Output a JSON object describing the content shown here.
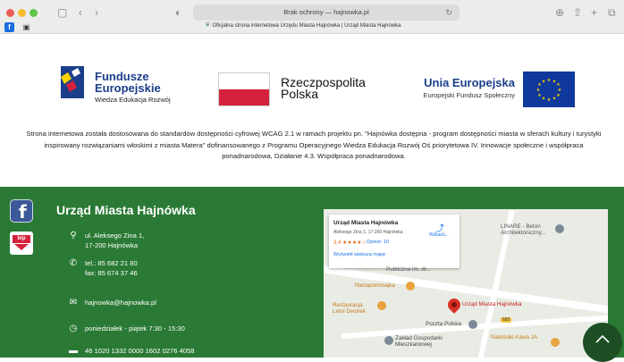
{
  "browser": {
    "address": "Brak ochrony — hajnowka.pl",
    "tab_title": "Oficjalna strona internetowa Urzędu Miasta Hajnówka | Urząd Miasta Hajnówka"
  },
  "logos": {
    "fe_line1": "Fundusze",
    "fe_line2": "Europejskie",
    "fe_line3": "Wiedza Edukacja Rozwój",
    "pl_line1": "Rzeczpospolita",
    "pl_line2": "Polska",
    "ue_line1": "Unia Europejska",
    "ue_line2": "Europejski Fundusz Społeczny"
  },
  "notice": "Strona internetowa została dostosowana do standardów dostępności cyfrowej WCAG 2.1 w ramach projektu pn. \"Hajnówka dostępna - program dostępności miasta w sferach kultury i turystyki inspirowany rozwiązaniami włoskimi z miasta Matera\" dofinansowanego z Programu Operacyjnego Wiedza Edukacja Rozwój Oś priorytetowa IV. Innowacje społeczne i współpraca ponadnarodowa, Działanie 4.3. Współpraca ponadnarodowa.",
  "footer": {
    "title": "Urząd Miasta Hajnówka",
    "address_line1": "ul. Aleksego Zina 1,",
    "address_line2": "17-200 Hajnówka",
    "tel": "tel.: 85 682 21 80",
    "fax": "fax: 85 674 37 46",
    "email": "hajnowka@hajnowka.pl",
    "hours": "poniedziałek - piątek 7:30 - 15:30",
    "bank": "46 1020 1332 0000 1602 0276 4058",
    "bip_label": "bip"
  },
  "map": {
    "card_name": "Urząd Miasta Hajnówka",
    "card_address": "Aleksego Zina 1, 17-200 Hajnówka",
    "rating": "3,4 ★★★★☆",
    "reviews": "Opinie: 10",
    "larger_map": "Wyświetl większą mapę",
    "directions": "Wskazó...",
    "poi_linare": "LINARE - Beton",
    "poi_linare2": "Architektoniczny...",
    "poi_szkola": "Publiczna im. dr...",
    "poi_niezapominajka": "Niezapominajka",
    "poi_restauracja1": "Restauracja",
    "poi_restauracja2": "Letni Dworek",
    "poi_urzad": "Urząd Miasta Hajnówka",
    "poi_poczta": "Poczta Polska",
    "poi_zaklad1": "Zakład Gospodarki",
    "poi_zaklad2": "Mieszkaniowej",
    "poi_nalesniki": "Naleśniki Kawa JA",
    "road_badge": "685"
  }
}
